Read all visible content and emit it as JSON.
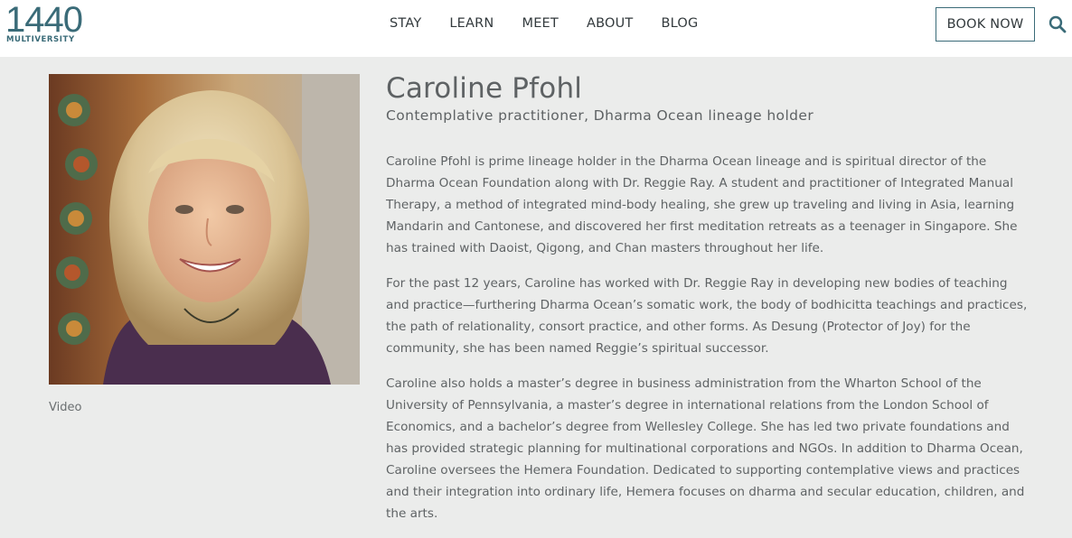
{
  "header": {
    "logo_number": "1440",
    "logo_subtitle": "MULTIVERSITY",
    "nav": [
      "STAY",
      "LEARN",
      "MEET",
      "ABOUT",
      "BLOG"
    ],
    "book_label": "BOOK NOW"
  },
  "profile": {
    "name": "Caroline Pfohl",
    "subtitle": "Contemplative practitioner, Dharma Ocean lineage holder",
    "photo_caption": "Video",
    "bio": [
      "Caroline Pfohl is prime lineage holder in the Dharma Ocean lineage and is spiritual director of the Dharma Ocean Foundation along with Dr. Reggie Ray. A student and practitioner of Integrated Manual Therapy, a method of integrated mind-body healing, she grew up traveling and living in Asia, learning Mandarin and Cantonese, and discovered her first meditation retreats as a teenager in Singapore. She has trained with Daoist, Qigong, and Chan masters throughout her life.",
      "For the past 12 years, Caroline has worked with Dr. Reggie Ray in developing new bodies of teaching and practice—furthering Dharma Ocean’s somatic work, the body of bodhicitta teachings and practices, the path of relationality, consort practice, and other forms. As Desung (Protector of Joy) for the community, she has been named Reggie’s spiritual successor.",
      "Caroline also holds a master’s degree in business administration from the Wharton School of the University of Pennsylvania, a master’s degree in international relations from the London School of Economics, and a bachelor’s degree from Wellesley College. She has led two private foundations and has provided strategic planning for multinational corporations and NGOs. In addition to Dharma Ocean, Caroline oversees the Hemera Foundation. Dedicated to supporting contemplative views and practices and their integration into ordinary life, Hemera focuses on dharma and secular education, children, and the arts."
    ]
  },
  "colors": {
    "brand": "#3a6b78",
    "page_background": "#ebeceb",
    "header_background": "#ffffff",
    "text": "#5f6365"
  }
}
